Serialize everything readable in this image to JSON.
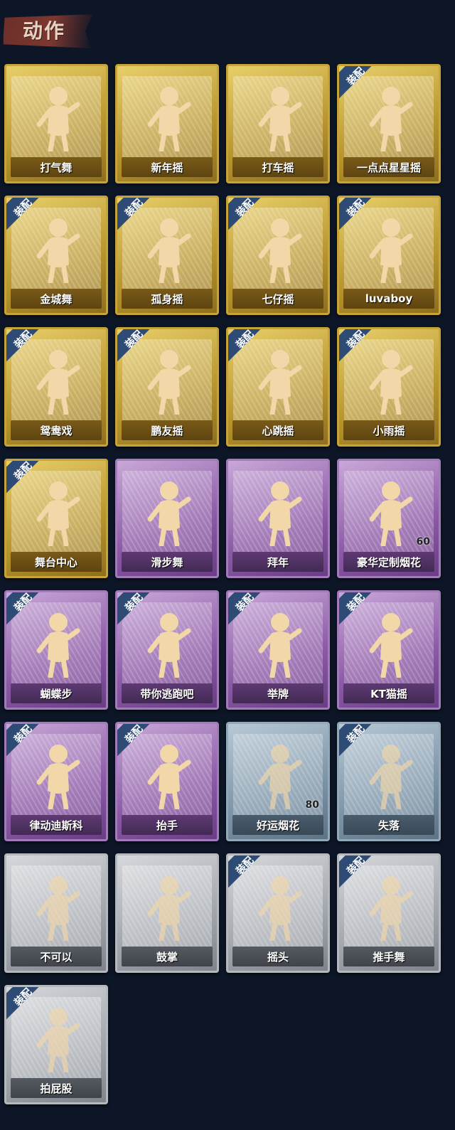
{
  "section_title": "动作",
  "items": [
    {
      "label": "打气舞",
      "tier": "gold",
      "equipped": false
    },
    {
      "label": "新年摇",
      "tier": "gold",
      "equipped": false
    },
    {
      "label": "打车摇",
      "tier": "gold",
      "equipped": false
    },
    {
      "label": "一点点星星摇",
      "tier": "gold",
      "equipped": true
    },
    {
      "label": "金城舞",
      "tier": "gold",
      "equipped": true
    },
    {
      "label": "孤身摇",
      "tier": "gold",
      "equipped": true
    },
    {
      "label": "七仔摇",
      "tier": "gold",
      "equipped": true
    },
    {
      "label": "luvaboy",
      "tier": "gold",
      "equipped": true
    },
    {
      "label": "鸳鸯戏",
      "tier": "gold",
      "equipped": true
    },
    {
      "label": "鹏友摇",
      "tier": "gold",
      "equipped": true
    },
    {
      "label": "心跳摇",
      "tier": "gold",
      "equipped": true
    },
    {
      "label": "小雨摇",
      "tier": "gold",
      "equipped": true
    },
    {
      "label": "舞台中心",
      "tier": "gold",
      "equipped": true
    },
    {
      "label": "滑步舞",
      "tier": "purple",
      "equipped": false
    },
    {
      "label": "拜年",
      "tier": "purple",
      "equipped": false
    },
    {
      "label": "豪华定制烟花",
      "tier": "purple",
      "equipped": false,
      "count": "60"
    },
    {
      "label": "蝴蝶步",
      "tier": "purple",
      "equipped": true
    },
    {
      "label": "带你逃跑吧",
      "tier": "purple",
      "equipped": true
    },
    {
      "label": "举牌",
      "tier": "purple",
      "equipped": true
    },
    {
      "label": "KT猫摇",
      "tier": "purple",
      "equipped": true
    },
    {
      "label": "律动迪斯科",
      "tier": "purple",
      "equipped": true
    },
    {
      "label": "抬手",
      "tier": "purple",
      "equipped": true
    },
    {
      "label": "好运烟花",
      "tier": "blue",
      "equipped": false,
      "count": "80"
    },
    {
      "label": "失落",
      "tier": "blue",
      "equipped": true
    },
    {
      "label": "不可以",
      "tier": "gray",
      "equipped": false
    },
    {
      "label": "鼓掌",
      "tier": "gray",
      "equipped": false
    },
    {
      "label": "摇头",
      "tier": "gray",
      "equipped": true
    },
    {
      "label": "推手舞",
      "tier": "gray",
      "equipped": true
    },
    {
      "label": "拍屁股",
      "tier": "gray",
      "equipped": true
    }
  ],
  "equipped_label": "装配",
  "colors": {
    "background": "#0d1626",
    "gold": "#c7a43a",
    "purple": "#8c5aa6",
    "blue": "#7c94a7",
    "gray": "#a2a6ad",
    "equipped_corner": "#2d4b74"
  }
}
